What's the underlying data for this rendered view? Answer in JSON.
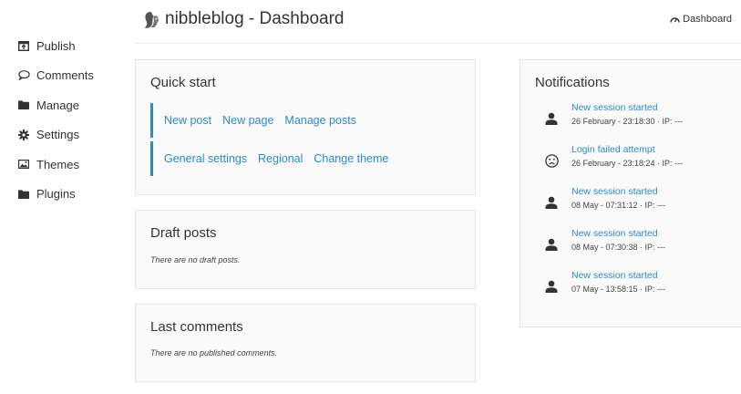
{
  "sidebar": {
    "items": [
      {
        "label": "Publish",
        "icon": "publish-icon"
      },
      {
        "label": "Comments",
        "icon": "comment-icon"
      },
      {
        "label": "Manage",
        "icon": "folder-icon"
      },
      {
        "label": "Settings",
        "icon": "gear-icon"
      },
      {
        "label": "Themes",
        "icon": "image-icon"
      },
      {
        "label": "Plugins",
        "icon": "folder-icon"
      }
    ]
  },
  "header": {
    "title": "nibbleblog - Dashboard",
    "dashboard_link": "Dashboard"
  },
  "quick_start": {
    "title": "Quick start",
    "row1": [
      "New post",
      "New page",
      "Manage posts"
    ],
    "row2": [
      "General settings",
      "Regional",
      "Change theme"
    ]
  },
  "draft_posts": {
    "title": "Draft posts",
    "empty": "There are no draft posts."
  },
  "last_comments": {
    "title": "Last comments",
    "empty": "There are no published comments."
  },
  "notifications": {
    "title": "Notifications",
    "items": [
      {
        "title": "New session started",
        "date": "26 February - 23:18:30 · IP: ---",
        "icon": "user-icon"
      },
      {
        "title": "Login failed attempt",
        "date": "26 February - 23:18:24 · IP: ---",
        "icon": "sad-face-icon"
      },
      {
        "title": "New session started",
        "date": "08 May - 07:31:12 · IP: ---",
        "icon": "user-icon"
      },
      {
        "title": "New session started",
        "date": "08 May - 07:30:38 · IP: ---",
        "icon": "user-icon"
      },
      {
        "title": "New session started",
        "date": "07 May - 13:58:15 · IP: ---",
        "icon": "user-icon"
      }
    ]
  },
  "colors": {
    "link": "#2d8ac7",
    "panel_bg": "#fafafa",
    "panel_border": "#e6e6e6"
  }
}
